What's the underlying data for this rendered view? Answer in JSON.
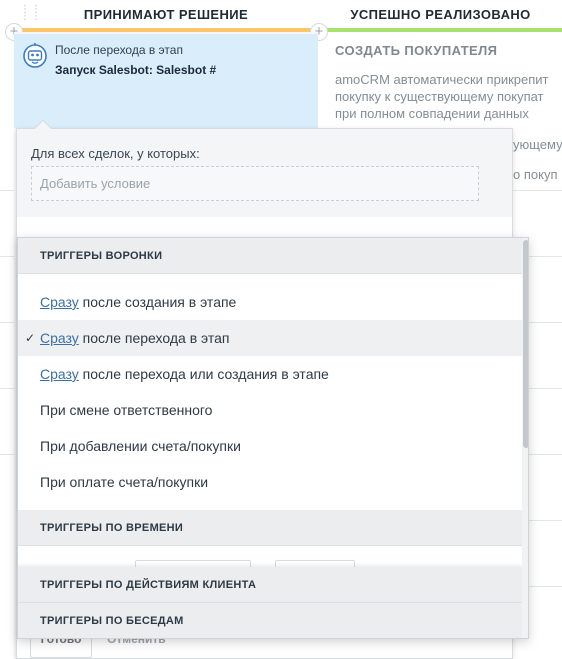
{
  "columns": [
    {
      "title": "ПРИНИМАЮТ РЕШЕНИЕ",
      "accent": "#fbc56a"
    },
    {
      "title": "УСПЕШНО РЕАЛИЗОВАНО",
      "accent": "#a9e36f"
    }
  ],
  "action_card": {
    "icon": "robot-icon",
    "caption": "После перехода в этап",
    "title": "Запуск Salesbot: Salesbot #"
  },
  "right_column": {
    "action_title": "СОЗДАТЬ ПОКУПАТЕЛЯ",
    "description_lines": [
      "amoCRM автоматически прикрепит",
      "покупку к существующему покупат",
      "при полном совпадении данных"
    ],
    "fragment_1": "ующему",
    "fragment_2": "о покуп"
  },
  "condition_panel": {
    "label": "Для всех сделок, у которых:",
    "placeholder": "Добавить условие",
    "ok_label": "Готово",
    "cancel_label": "Отменить"
  },
  "dropdown": {
    "sections": {
      "funnel": "ТРИГГЕРЫ ВОРОНКИ",
      "time": "ТРИГГЕРЫ ПО ВРЕМЕНИ",
      "client": "ТРИГГЕРЫ ПО ДЕЙСТВИЯМ КЛИЕНТА",
      "chat": "ТРИГГЕРЫ ПО БЕСЕДАМ"
    },
    "items": [
      {
        "link": "Сразу",
        "text": " после создания в этапе"
      },
      {
        "link": "Сразу",
        "text": " после перехода в этап",
        "selected": true
      },
      {
        "link": "Сразу",
        "text": " после перехода или создания в этапе"
      },
      {
        "text": "При смене ответственного"
      },
      {
        "text": "При добавлении счета/покупки"
      },
      {
        "text": "При оплате счета/покупки"
      }
    ],
    "check_mark": "✓",
    "link_color": "#3c6fa4"
  }
}
